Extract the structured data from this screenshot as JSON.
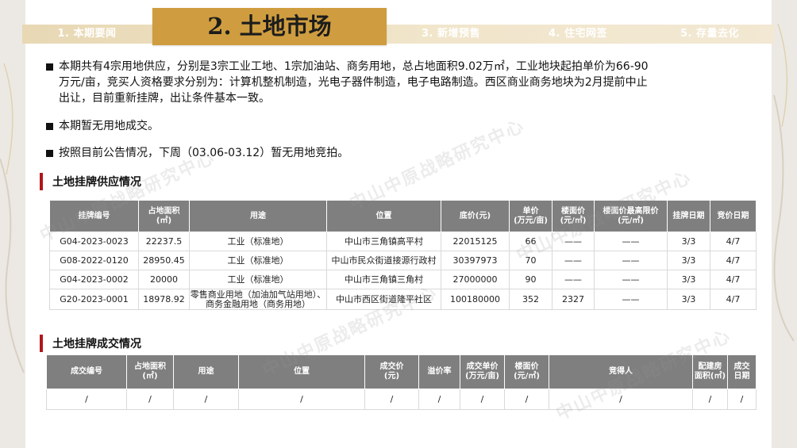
{
  "tabs": [
    {
      "label": "1. 本期要闻"
    },
    {
      "label": "2. 土地市场"
    },
    {
      "label": "3. 新增预售"
    },
    {
      "label": "4. 住宅网签"
    },
    {
      "label": "5. 存量去化"
    }
  ],
  "bullets": [
    {
      "lines": [
        "本期共有4宗用地供应，分别是3宗工业工地、1宗加油站、商务用地，总占地面积9.02万㎡，工业地块起拍单价为66-90",
        "万元/亩，竞买人资格要求分别为：计算机整机制造，光电子器件制造，电子电路制造。西区商业商务地块为2月提前中止",
        "出让，目前重新挂牌，出让条件基本一致。"
      ]
    },
    {
      "lines": [
        "本期暂无用地成交。"
      ]
    },
    {
      "lines": [
        "按照目前公告情况，下周（03.06-03.12）暂无用地竞拍。"
      ]
    }
  ],
  "supply": {
    "title": "土地挂牌供应情况",
    "headers": [
      [
        "挂牌编号"
      ],
      [
        "占地面积",
        "(㎡)"
      ],
      [
        "用途"
      ],
      [
        "位置"
      ],
      [
        "底价(元)"
      ],
      [
        "单价",
        "(万元/亩)"
      ],
      [
        "楼面价",
        "(元/㎡)"
      ],
      [
        "楼面价最高限价",
        "(元/㎡)"
      ],
      [
        "挂牌日期"
      ],
      [
        "竞价日期"
      ]
    ],
    "rows": [
      {
        "code": "G04-2023-0023",
        "area": "22237.5",
        "use": [
          "工业（标准地）"
        ],
        "location": "中山市三角镇高平村",
        "price": "22015125",
        "unit": "66",
        "floor": "——",
        "cap": "——",
        "list_date": "3/3",
        "bid_date": "4/7"
      },
      {
        "code": "G08-2022-0120",
        "area": "28950.45",
        "use": [
          "工业（标准地）"
        ],
        "location": "中山市民众街道接源行政村",
        "price": "30397973",
        "unit": "70",
        "floor": "——",
        "cap": "——",
        "list_date": "3/3",
        "bid_date": "4/7"
      },
      {
        "code": "G04-2023-0002",
        "area": "20000",
        "use": [
          "工业（标准地）"
        ],
        "location": "中山市三角镇三角村",
        "price": "27000000",
        "unit": "90",
        "floor": "——",
        "cap": "——",
        "list_date": "3/3",
        "bid_date": "4/7"
      },
      {
        "code": "G20-2023-0001",
        "area": "18978.92",
        "use": [
          "零售商业用地（加油加气站用地）、",
          "商务金融用地（商务用地）"
        ],
        "location": "中山市西区街道隆平社区",
        "price": "100180000",
        "unit": "352",
        "floor": "2327",
        "cap": "——",
        "list_date": "3/3",
        "bid_date": "4/7"
      }
    ]
  },
  "deal": {
    "title": "土地挂牌成交情况",
    "headers": [
      [
        "成交编号"
      ],
      [
        "占地面积",
        "(㎡)"
      ],
      [
        "用途"
      ],
      [
        "位置"
      ],
      [
        "成交价",
        "(元)"
      ],
      [
        "溢价率"
      ],
      [
        "成交单价",
        "(万元/亩)"
      ],
      [
        "楼面价",
        "(元/㎡)"
      ],
      [
        "竞得人"
      ],
      [
        "配建房",
        "面积(㎡)"
      ],
      [
        "成交",
        "日期"
      ]
    ],
    "rows": [
      [
        "/",
        "/",
        "/",
        "/",
        "/",
        "/",
        "/",
        "/",
        "/",
        "/",
        "/"
      ]
    ]
  },
  "watermark": "中山中原战略研究中心",
  "colors": {
    "accent_gold": "#cf9d3f",
    "section_red": "#b1151a",
    "header_gray": "#7f7f7f"
  }
}
